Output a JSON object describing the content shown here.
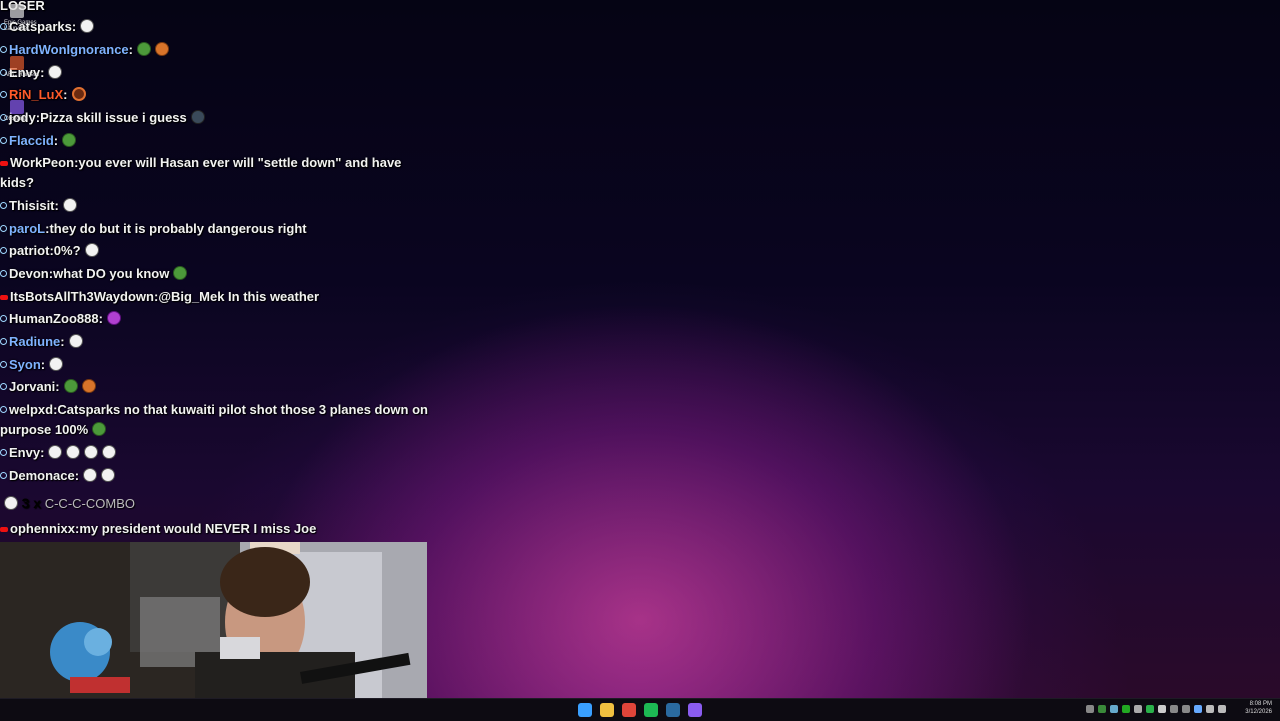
{
  "chat": {
    "top_partial": "LOSER",
    "messages": [
      {
        "user": "Catsparks",
        "sep": ":",
        "text": "",
        "user_color": "#f2f2f2",
        "badge": "blue",
        "emotes": [
          "white"
        ]
      },
      {
        "user": "HardWonIgnorance",
        "sep": ":",
        "text": "",
        "user_color": "#7fb2ff",
        "badge": "blue",
        "emotes": [
          "green",
          "orange"
        ]
      },
      {
        "user": "Envy",
        "sep": ":",
        "text": "",
        "user_color": "#f2f2f2",
        "badge": "blue",
        "emotes": [
          "white"
        ]
      },
      {
        "user": "RiN_LuX",
        "sep": ":",
        "text": "",
        "user_color": "#ff5a2a",
        "badge": "blue",
        "emotes": [
          "brown"
        ]
      },
      {
        "user": "jody",
        "sep": ":",
        "text": "Pizza skill issue i guess",
        "user_color": "#f2f2f2",
        "badge": "blue",
        "emotes": [
          "dark"
        ]
      },
      {
        "user": "Flaccid",
        "sep": ":",
        "text": "",
        "user_color": "#7fb2ff",
        "badge": "blue",
        "emotes": [
          "green"
        ]
      },
      {
        "user": "WorkPeon",
        "sep": ":",
        "text": "you ever will Hasan ever will \"settle down\" and have kids?",
        "user_color": "#f2f2f2",
        "badge": "red",
        "emotes": []
      },
      {
        "user": "Thisisit",
        "sep": ":",
        "text": "",
        "user_color": "#f2f2f2",
        "badge": "blue",
        "emotes": [
          "white"
        ]
      },
      {
        "user": "paroL",
        "sep": ":",
        "text": "they do but it is probably dangerous right",
        "user_color": "#7fb2ff",
        "badge": "blue",
        "emotes": []
      },
      {
        "user": "patriot",
        "sep": ":",
        "text": "0%?",
        "user_color": "#f2f2f2",
        "badge": "blue",
        "emotes": [
          "white"
        ]
      },
      {
        "user": "Devon",
        "sep": ":",
        "text": "what DO you know",
        "user_color": "#f2f2f2",
        "badge": "blue",
        "emotes": [
          "green"
        ]
      },
      {
        "user": "ItsBotsAllTh3Waydown",
        "sep": ":",
        "text": "@Big_Mek In this weather",
        "user_color": "#f2f2f2",
        "badge": "red",
        "emotes": []
      },
      {
        "user": "HumanZoo888",
        "sep": ":",
        "text": "",
        "user_color": "#f2f2f2",
        "badge": "blue",
        "emotes": [
          "purple"
        ]
      },
      {
        "user": "Radiune",
        "sep": ":",
        "text": "",
        "user_color": "#7fb2ff",
        "badge": "blue",
        "emotes": [
          "white"
        ]
      },
      {
        "user": "Syon",
        "sep": ":",
        "text": "",
        "user_color": "#7fb2ff",
        "badge": "blue",
        "emotes": [
          "white"
        ]
      },
      {
        "user": "Jorvani",
        "sep": ":",
        "text": "",
        "user_color": "#f2f2f2",
        "badge": "blue",
        "emotes": [
          "green",
          "orange"
        ]
      },
      {
        "user": "welpxd",
        "sep": ":",
        "text": "Catsparks no that kuwaiti pilot shot those 3 planes down on purpose 100%",
        "user_color": "#f2f2f2",
        "badge": "blue",
        "emotes": [
          "green"
        ]
      },
      {
        "user": "Envy",
        "sep": ":",
        "text": "",
        "user_color": "#f2f2f2",
        "badge": "blue",
        "emotes": [
          "white",
          "white",
          "white",
          "white"
        ]
      },
      {
        "user": "Demonace",
        "sep": ":",
        "text": "",
        "user_color": "#f2f2f2",
        "badge": "blue",
        "emotes": [
          "white",
          "white"
        ]
      },
      {
        "user": "ophennixx",
        "sep": ":",
        "text": "my president would NEVER I miss Joe",
        "user_color": "#f2f2f2",
        "badge": "red",
        "emotes": []
      }
    ],
    "combo": {
      "count": "3 x",
      "label": "C-C-C-COMBO"
    }
  },
  "desktop_icons": [
    {
      "label": "Epic Games Launcher",
      "color": "#dddddd"
    },
    {
      "label": "ARC Raiders",
      "color": "#e05a2a"
    },
    {
      "label": "Obsidian",
      "color": "#8a5cf0"
    }
  ],
  "taskbar": {
    "apps": [
      {
        "name": "start-icon",
        "color": "#3aa0ff"
      },
      {
        "name": "file-explorer-icon",
        "color": "#f0c040"
      },
      {
        "name": "chrome-icon",
        "color": "#e0453a"
      },
      {
        "name": "spotify-icon",
        "color": "#1db954"
      },
      {
        "name": "steam-icon",
        "color": "#2a6aa0"
      },
      {
        "name": "obsidian-icon",
        "color": "#8a5cf0"
      }
    ],
    "clock": {
      "time": "8:08 PM",
      "date": "3/12/2026"
    }
  }
}
